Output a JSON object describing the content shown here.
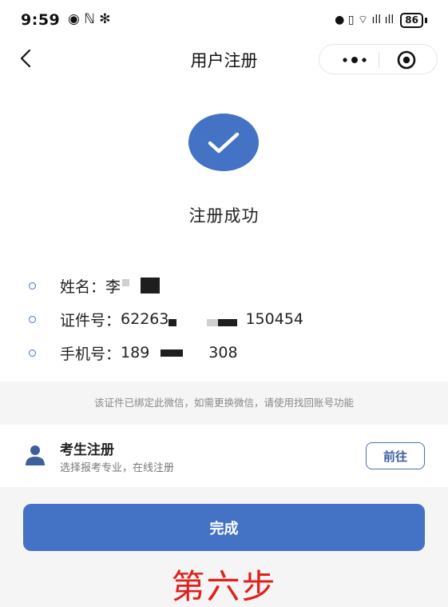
{
  "status_bar": {
    "time": "9:59",
    "left_icons": "◉ ℕ ✻",
    "right_icons": "● ▯ ⌔ ıll ıll",
    "battery": "86"
  },
  "nav": {
    "title": "用户注册",
    "back_icon": "chevron-left-icon",
    "more_icon": "more-dots-icon",
    "close_icon": "target-circle-icon"
  },
  "success": {
    "icon": "check-circle-icon",
    "text": "注册成功",
    "accent": "#4472c4"
  },
  "info": [
    {
      "label": "姓名：",
      "value_start": "李",
      "value_end": ""
    },
    {
      "label": "证件号：",
      "value_start": "62263",
      "value_end": "150454"
    },
    {
      "label": "手机号：",
      "value_start": "189",
      "value_end": "308"
    }
  ],
  "notice": "该证件已绑定此微信，如需更换微信，请使用找回账号功能",
  "exam": {
    "icon": "person-icon",
    "title": "考生注册",
    "subtitle": "选择报考专业，在线注册",
    "button": "前往"
  },
  "done_button": "完成",
  "caption": "第六步",
  "caption_color": "#e0201b"
}
